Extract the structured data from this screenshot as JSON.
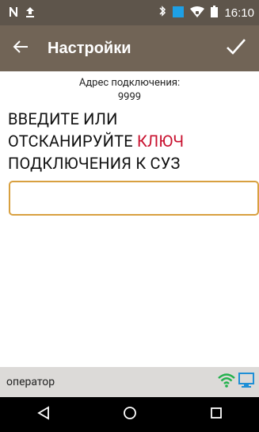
{
  "status_bar": {
    "time": "16:10",
    "icons": [
      "n-notification-icon",
      "upload-icon",
      "bluetooth-icon",
      "blue-square-icon",
      "wifi-icon",
      "battery-icon"
    ]
  },
  "app_bar": {
    "title": "Настройки",
    "back_icon": "arrow-left-icon",
    "confirm_icon": "check-icon"
  },
  "connection": {
    "address_label": "Адрес подключения:",
    "address_value": "9999"
  },
  "prompt": {
    "part1": "ВВЕДИТЕ ИЛИ",
    "part2": "ОТСКАНИРУЙТЕ ",
    "highlight": "КЛЮЧ",
    "part3": "ПОДКЛЮЧЕНИЯ К СУЗ"
  },
  "key_input": {
    "value": "",
    "placeholder": ""
  },
  "bottom_status": {
    "role": "оператор",
    "icons": [
      "wifi-icon",
      "monitor-icon"
    ]
  },
  "nav_bar": {
    "icons": [
      "back-triangle-icon",
      "home-circle-icon",
      "recents-square-icon"
    ]
  },
  "colors": {
    "status_bar": "#5e554b",
    "app_bar": "#716456",
    "highlight": "#c8102e",
    "input_border": "#d8a040",
    "bottom_status": "#dcdad8",
    "wifi_green": "#22b14c",
    "monitor_blue": "#1e8fd6"
  }
}
